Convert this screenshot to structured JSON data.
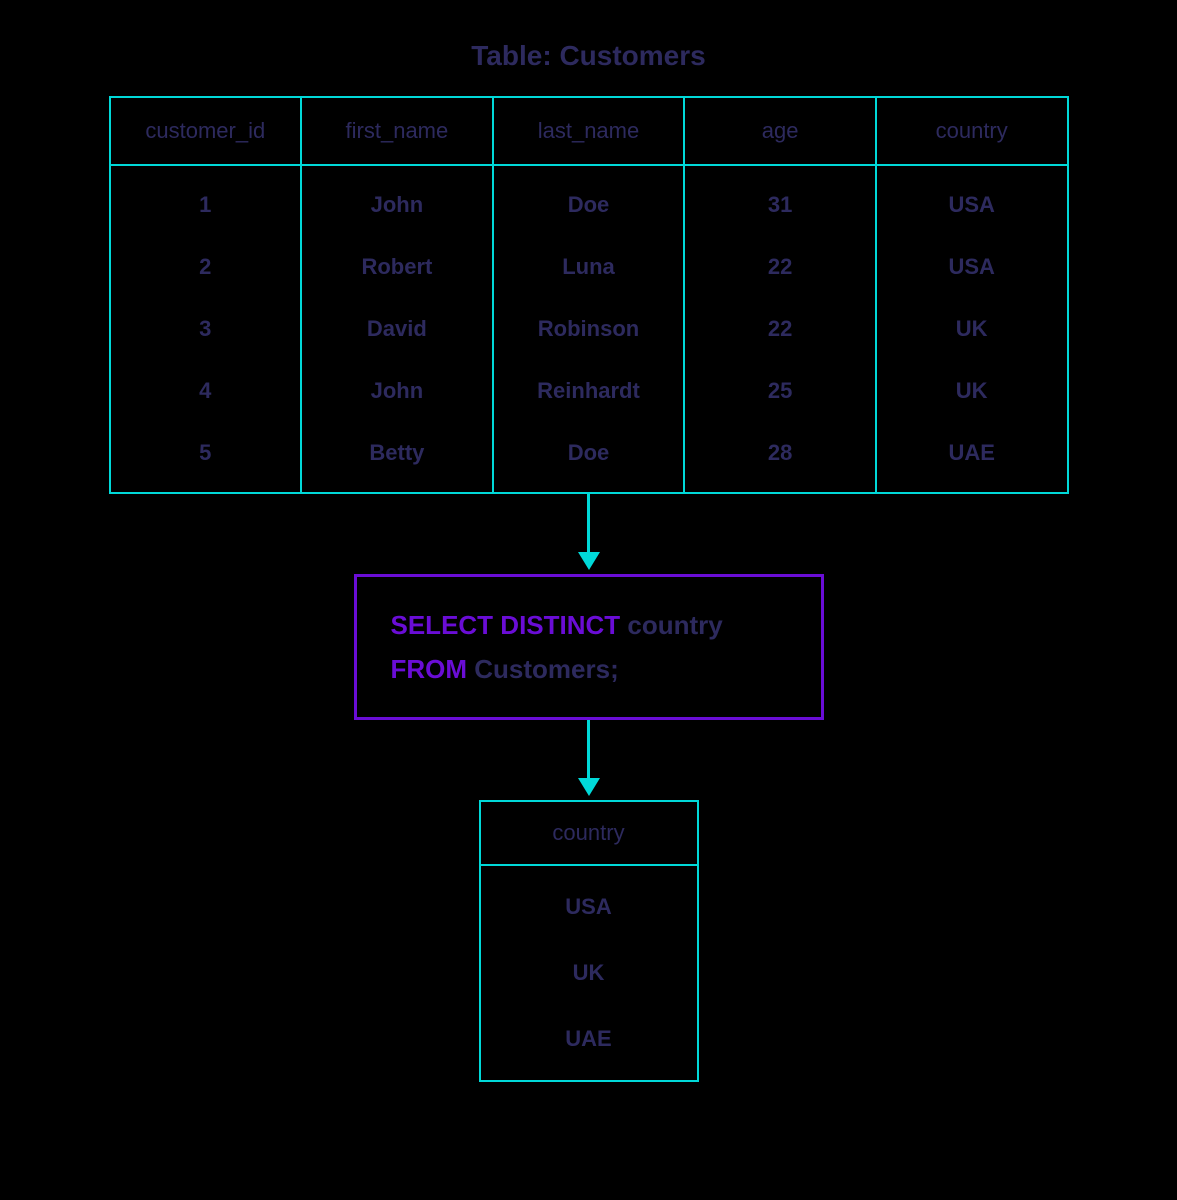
{
  "title": "Table: Customers",
  "colors": {
    "bg": "#000000",
    "tableBorder": "#00d9d9",
    "text": "#2d2a5e",
    "sqlBorder": "#6a0dd6",
    "sqlKeyword": "#6a0dd6"
  },
  "customers": {
    "headers": [
      "customer_id",
      "first_name",
      "last_name",
      "age",
      "country"
    ],
    "rows": [
      [
        "1",
        "John",
        "Doe",
        "31",
        "USA"
      ],
      [
        "2",
        "Robert",
        "Luna",
        "22",
        "USA"
      ],
      [
        "3",
        "David",
        "Robinson",
        "22",
        "UK"
      ],
      [
        "4",
        "John",
        "Reinhardt",
        "25",
        "UK"
      ],
      [
        "5",
        "Betty",
        "Doe",
        "28",
        "UAE"
      ]
    ]
  },
  "sql": {
    "line1_kw": "SELECT DISTINCT",
    "line1_id": " country",
    "line2_kw": "FROM",
    "line2_id": " Customers;"
  },
  "result": {
    "header": "country",
    "rows": [
      "USA",
      "UK",
      "UAE"
    ]
  }
}
